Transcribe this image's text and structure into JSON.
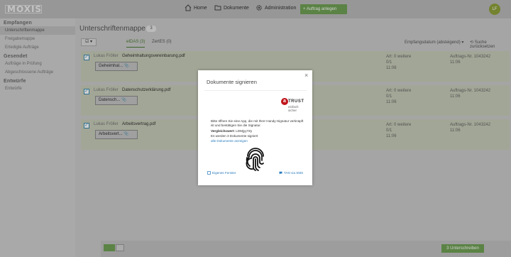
{
  "app": {
    "logo_text": "MOXIS",
    "avatar_initials": "LF",
    "nav": [
      {
        "label": "Home",
        "icon": "home-icon"
      },
      {
        "label": "Dokumente",
        "icon": "folder-icon"
      },
      {
        "label": "Administration",
        "icon": "gear-icon"
      }
    ],
    "order_button": "+  Auftrag anlegen"
  },
  "sidebar": {
    "sections": [
      {
        "heading": "Empfangen",
        "items": [
          "Unterschriftenmappe",
          "Freigabemappe",
          "Erledigte Aufträge"
        ]
      },
      {
        "heading": "Gesendet",
        "items": [
          "Aufträge in Prüfung",
          "Abgeschlossene Aufträge"
        ]
      },
      {
        "heading": "Entwürfe",
        "items": [
          "Entwürfe"
        ]
      }
    ]
  },
  "main": {
    "title": "Unterschriftenmappe",
    "count": "3",
    "toggle": "☑ ▾",
    "tabs": [
      {
        "label": "eIDAS (3)"
      },
      {
        "label": "ZertES (0)"
      }
    ],
    "sort_label": "Empfangsdatum (absteigend)  ▾",
    "reset_label": "⟲  Suche zurücksetzen",
    "rows": [
      {
        "sender": "Lukas Fröller",
        "file": "Geheimhaltungsvereinbarung.pdf",
        "file_btn": "Geheimhal...  📎",
        "meta1": "Art: 0 weitere",
        "meta2": "0/1",
        "meta3": "11:06",
        "order": "Auftrags-Nr. 1043242",
        "order_date": "11:06"
      },
      {
        "sender": "Lukas Fröller",
        "file": "Datenschutzerklärung.pdf",
        "file_btn": "Datensch...  📎",
        "meta1": "Art: 0 weitere",
        "meta2": "0/1",
        "meta3": "11:06",
        "order": "Auftrags-Nr. 1043242",
        "order_date": "11:06"
      },
      {
        "sender": "Lukas Fröller",
        "file": "Arbeitsvertrag.pdf",
        "file_btn": "Arbeitsvert...  📎",
        "meta1": "Art: 0 weitere",
        "meta2": "0/1",
        "meta3": "11:06",
        "order": "Auftrags-Nr. 1043242",
        "order_date": "11:06"
      }
    ],
    "bottom_sign_button": "3 Unterschreiben"
  },
  "modal": {
    "title": "Dokumente signieren",
    "close": "×",
    "brand_main": "TRUST",
    "brand_sub": "einfach sicher",
    "instruction": "Bitte öffnen Sie eine App, die mit Ihrer Handy-Signatur verknüpft ist und bestätigen Sie die Signatur.",
    "compare_label": "Vergleichswert:",
    "compare_value": "LDMjyy7Zy",
    "doc_count": "Es werden 3 Dokumente signiert",
    "all_docs_link": "alle Dokumente anzeigen",
    "own_window_link": "Eigenes Fenster",
    "tan_link": "TAN via SMS"
  }
}
